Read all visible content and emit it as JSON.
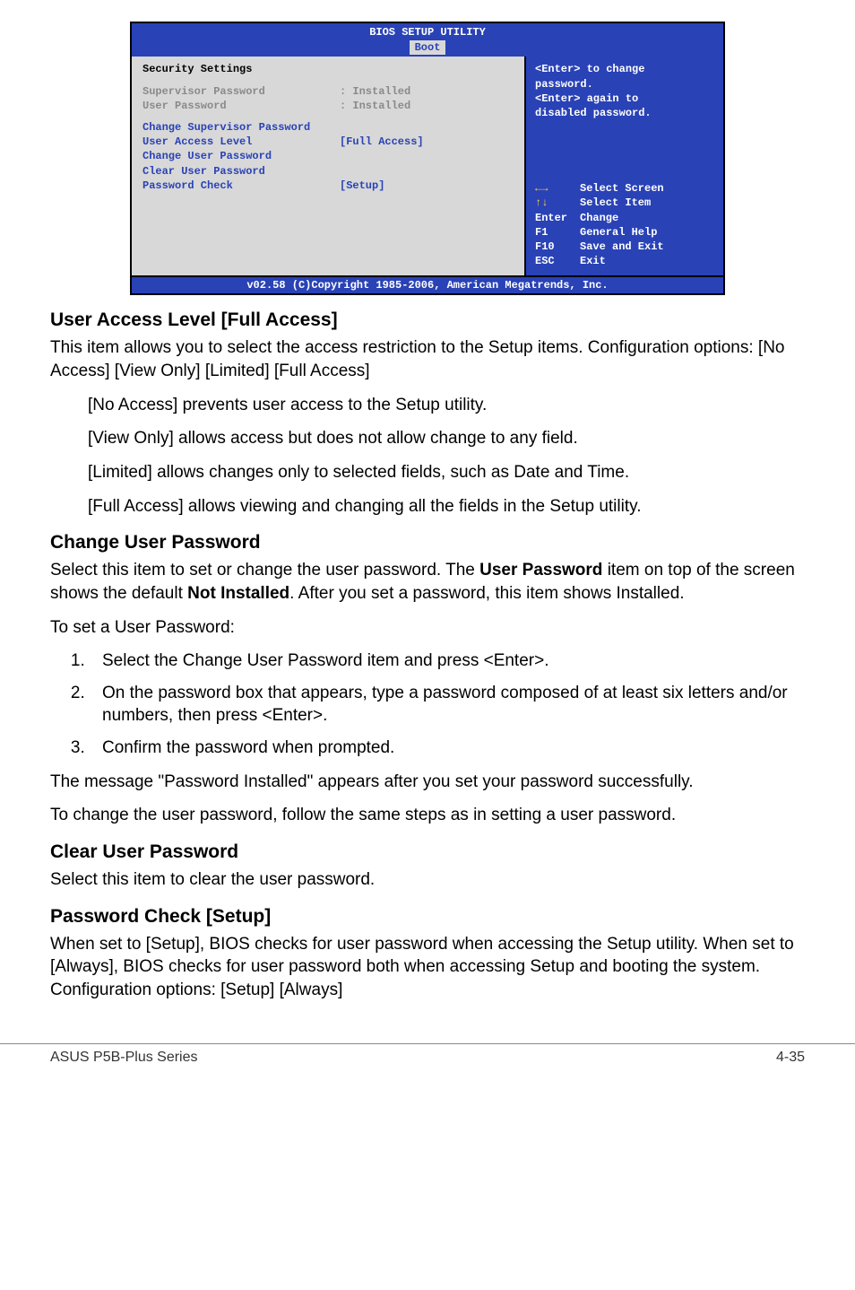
{
  "bios": {
    "header_title": "BIOS SETUP UTILITY",
    "tab": "Boot",
    "section_title": "Security Settings",
    "sup_pw_label": "Supervisor Password",
    "sup_pw_value": ": Installed",
    "user_pw_label": "User Password",
    "user_pw_value": ": Installed",
    "rows": {
      "change_sup": "Change Supervisor Password",
      "ual_label": "User Access Level",
      "ual_value": "[Full Access]",
      "change_user": "Change User Password",
      "clear_user": "Clear User Password",
      "pwcheck_label": "Password Check",
      "pwcheck_value": "[Setup]"
    },
    "help": {
      "line1": "<Enter> to change",
      "line2": "password.",
      "line3": "<Enter> again to",
      "line4": "disabled password."
    },
    "keys": {
      "arrows_h": "←→",
      "arrows_v": "↑↓",
      "select_screen": "Select Screen",
      "select_item": "Select Item",
      "enter_k": "Enter",
      "enter_v": "Change",
      "f1_k": "F1",
      "f1_v": "General Help",
      "f10_k": "F10",
      "f10_v": "Save and Exit",
      "esc_k": "ESC",
      "esc_v": "Exit"
    },
    "footer": "v02.58 (C)Copyright 1985-2006, American Megatrends, Inc."
  },
  "s1": {
    "heading": "User Access Level [Full Access]",
    "p1": "This item allows you to select the access restriction to the Setup items. Configuration options: [No Access] [View Only] [Limited] [Full Access]",
    "b1": "[No Access] prevents user access to the Setup utility.",
    "b2": "[View Only] allows access but does not allow change to any field.",
    "b3": "[Limited] allows changes only to selected fields, such as Date and Time.",
    "b4": "[Full Access] allows viewing and changing all the fields in the Setup utility."
  },
  "s2": {
    "heading": "Change User Password",
    "p1a": "Select this item to set or change the user password. The ",
    "p1b": "User Password",
    "p1c": " item on top of the screen shows the default ",
    "p1d": "Not Installed",
    "p1e": ". After you set a password, this item shows Installed.",
    "p2": "To set a User Password:",
    "li1": "Select the Change User Password item and press <Enter>.",
    "li2": "On the password box that appears, type a password composed of at least six letters and/or numbers, then press <Enter>.",
    "li3": "Confirm the password when prompted.",
    "p3": "The message \"Password Installed\" appears after you set your password successfully.",
    "p4": "To change the user password, follow the same steps as in setting a user password."
  },
  "s3": {
    "heading": "Clear User Password",
    "p1": "Select this item to clear the user password."
  },
  "s4": {
    "heading": "Password Check [Setup]",
    "p1": "When set to [Setup], BIOS checks for user password when accessing the Setup utility. When set to [Always], BIOS checks for user password both when accessing Setup and booting the system. Configuration options: [Setup] [Always]"
  },
  "footer": {
    "left": "ASUS P5B-Plus Series",
    "right": "4-35"
  }
}
